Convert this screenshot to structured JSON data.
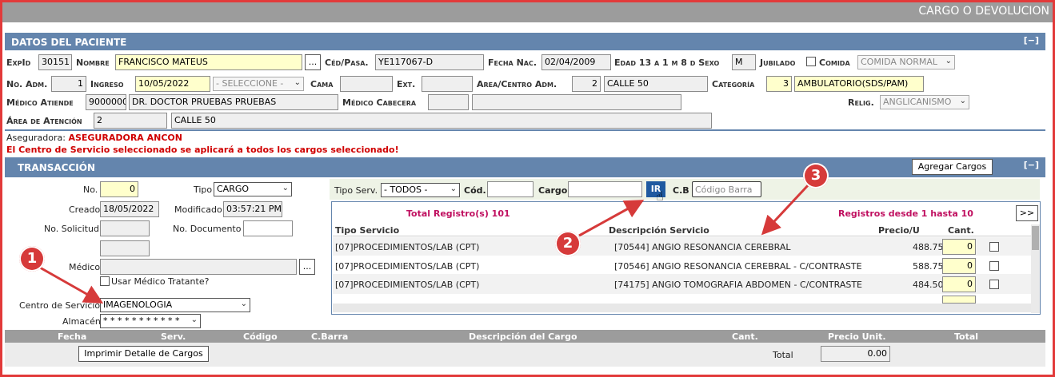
{
  "window": {
    "title": "CARGO O DEVOLUCION"
  },
  "patient": {
    "section_title": "DATOS DEL PACIENTE",
    "collapse": "[−]",
    "expid_label": "ExpId",
    "expid": "30151",
    "nombre_label": "Nombre",
    "nombre": "FRANCISCO MATEUS",
    "lookup_btn": "...",
    "ced_label": "Céd/Pasa.",
    "ced": "YE117067-D",
    "fecha_nac_label": "Fecha Nac.",
    "fecha_nac": "02/04/2009",
    "edad_label": "Edad 13 a 1 m 8 d Sexo",
    "sexo": "M",
    "jubilado_label": "Jubilado",
    "comida_label": "Comida",
    "comida": "COMIDA NORMAL",
    "no_adm_label": "No. Adm.",
    "no_adm": "1",
    "ingreso_label": "Ingreso",
    "ingreso": "10/05/2022",
    "seleccione": "- SELECCIONE -",
    "cama_label": "Cama",
    "ext_label": "Ext.",
    "area_centro_label": "Area/Centro Adm.",
    "area_centro_code": "2",
    "area_centro": "CALLE 50",
    "categoria_label": "Categoría",
    "categoria_code": "3",
    "categoria": "AMBULATORIO(SDS/PAM)",
    "medico_atiende_label": "Médico Atiende",
    "medico_code": "9000000",
    "medico": "DR. DOCTOR PRUEBAS PRUEBAS",
    "medico_cabecera_label": "Médico Cabecera",
    "relig_label": "Relig.",
    "relig": "ANGLICANISMO",
    "area_atencion_label": "Área de Atención",
    "area_atencion_code": "2",
    "area_atencion": "CALLE 50",
    "aseguradora_label": "Aseguradora:",
    "aseguradora": "ASEGURADORA ANCON",
    "warning": "El Centro de Servicio seleccionado se aplicará a todos los cargos seleccionado!"
  },
  "transaction": {
    "section_title": "TRANSACCIÓN",
    "collapse": "[−]",
    "agregar_btn": "Agregar Cargos",
    "no_label": "No.",
    "no": "0",
    "tipo_label": "Tipo",
    "tipo": "CARGO",
    "creado_label": "Creado",
    "creado": "18/05/2022",
    "modificado_label": "Modificado",
    "modificado": "03:57:21 PM",
    "no_solicitud_label": "No. Solicitud",
    "no_documento_label": "No. Documento",
    "medico_label": "Médico",
    "lookup_btn": "...",
    "usar_medico_label": "Usar Médico Tratante?",
    "centro_label": "Centro de Servicio",
    "centro": "IMAGENOLOGIA",
    "almacen_label": "Almacén",
    "almacen": "* * * * * * * * * * *"
  },
  "search": {
    "tipo_serv_label": "Tipo Serv.",
    "tipo_serv": "- TODOS -",
    "cod_label": "Cód.",
    "cargo_label": "Cargo",
    "ir_btn": "IR",
    "cb_label": "C.B",
    "cb_placeholder": "Código Barra",
    "total_registros": "Total Registro(s) 101",
    "registros_desde": "Registros desde 1 hasta 10",
    "next_btn": ">>"
  },
  "services_table": {
    "headers": [
      "Tipo Servicio",
      "Descripción Servicio",
      "Precio/U",
      "Cant."
    ],
    "rows": [
      {
        "tipo": "[07]PROCEDIMIENTOS/LAB (CPT)",
        "desc": "[70544] ANGIO RESONANCIA CEREBRAL",
        "precio": "488.75",
        "cant": "0"
      },
      {
        "tipo": "[07]PROCEDIMIENTOS/LAB (CPT)",
        "desc": "[70546] ANGIO RESONANCIA CEREBRAL - C/CONTRASTE",
        "precio": "588.75",
        "cant": "0"
      },
      {
        "tipo": "[07]PROCEDIMIENTOS/LAB (CPT)",
        "desc": "[74175] ANGIO TOMOGRAFIA ABDOMEN - C/CONTRASTE",
        "precio": "484.50",
        "cant": "0"
      }
    ]
  },
  "charges_table": {
    "headers": [
      "Fecha",
      "Serv.",
      "Código",
      "C.Barra",
      "Descripción del Cargo",
      "Cant.",
      "Precio Unit.",
      "Total"
    ],
    "print_btn": "Imprimir Detalle de Cargos",
    "total_label": "Total",
    "total": "0.00"
  },
  "markers": [
    "1",
    "2",
    "3"
  ],
  "colors": {
    "header_blue": "#6485ad",
    "frame_red": "#e23a3a",
    "highlight_yellow": "#ffffcc",
    "ir_button": "#1f5aa0"
  }
}
